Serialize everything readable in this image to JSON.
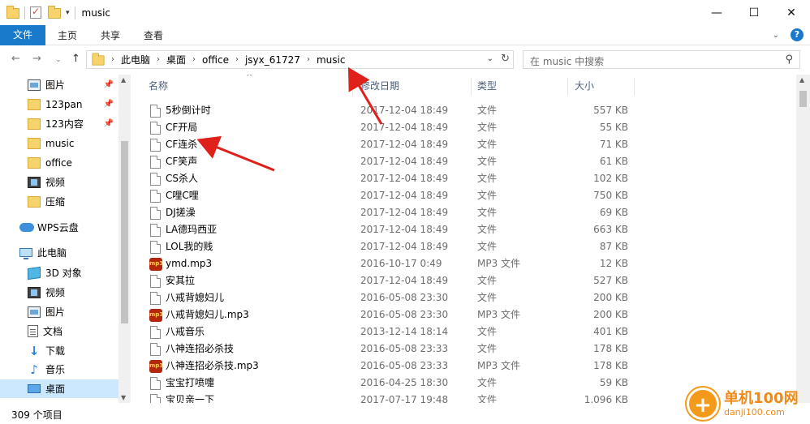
{
  "window": {
    "title": "music",
    "controls": {
      "minimize": "—",
      "maximize": "☐",
      "close": "✕"
    }
  },
  "ribbon": {
    "tabs": [
      "文件",
      "主页",
      "共享",
      "查看"
    ]
  },
  "address": {
    "breadcrumbs": [
      "此电脑",
      "桌面",
      "office",
      "jsyx_61727",
      "music"
    ],
    "search_placeholder": "在 music 中搜索"
  },
  "nav": {
    "items": [
      {
        "label": "图片",
        "icon": "pictures-icon",
        "pinned": true
      },
      {
        "label": "123pan",
        "icon": "folder-icon",
        "pinned": true
      },
      {
        "label": "123内容",
        "icon": "folder-icon",
        "pinned": true
      },
      {
        "label": "music",
        "icon": "folder-icon",
        "pinned": false
      },
      {
        "label": "office",
        "icon": "folder-icon",
        "pinned": false
      },
      {
        "label": "视频",
        "icon": "video-icon",
        "pinned": false
      },
      {
        "label": "压缩",
        "icon": "folder-icon",
        "pinned": false
      },
      {
        "label": "WPS云盘",
        "icon": "cloud-icon",
        "pinned": false
      },
      {
        "label": "此电脑",
        "icon": "pc-icon",
        "pinned": false
      },
      {
        "label": "3D 对象",
        "icon": "3d-objects-icon",
        "pinned": false
      },
      {
        "label": "视频",
        "icon": "video-icon",
        "pinned": false
      },
      {
        "label": "图片",
        "icon": "pictures-icon",
        "pinned": false
      },
      {
        "label": "文档",
        "icon": "documents-icon",
        "pinned": false
      },
      {
        "label": "下载",
        "icon": "download-icon",
        "pinned": false
      },
      {
        "label": "音乐",
        "icon": "music-icon",
        "pinned": false
      },
      {
        "label": "桌面",
        "icon": "desktop-icon",
        "pinned": false,
        "selected": true
      }
    ]
  },
  "files": {
    "columns": {
      "name": "名称",
      "modified": "修改日期",
      "type": "类型",
      "size": "大小"
    },
    "rows": [
      {
        "name": "5秒倒计时",
        "modified": "2017-12-04 18:49",
        "type": "文件",
        "size": "557 KB",
        "icon": "blank"
      },
      {
        "name": "CF开局",
        "modified": "2017-12-04 18:49",
        "type": "文件",
        "size": "55 KB",
        "icon": "blank"
      },
      {
        "name": "CF连杀",
        "modified": "2017-12-04 18:49",
        "type": "文件",
        "size": "71 KB",
        "icon": "blank"
      },
      {
        "name": "CF笑声",
        "modified": "2017-12-04 18:49",
        "type": "文件",
        "size": "61 KB",
        "icon": "blank"
      },
      {
        "name": "CS杀人",
        "modified": "2017-12-04 18:49",
        "type": "文件",
        "size": "102 KB",
        "icon": "blank"
      },
      {
        "name": "C哩C哩",
        "modified": "2017-12-04 18:49",
        "type": "文件",
        "size": "750 KB",
        "icon": "blank"
      },
      {
        "name": "DJ搓澡",
        "modified": "2017-12-04 18:49",
        "type": "文件",
        "size": "69 KB",
        "icon": "blank"
      },
      {
        "name": "LA德玛西亚",
        "modified": "2017-12-04 18:49",
        "type": "文件",
        "size": "663 KB",
        "icon": "blank"
      },
      {
        "name": "LOL我的贱",
        "modified": "2017-12-04 18:49",
        "type": "文件",
        "size": "87 KB",
        "icon": "blank"
      },
      {
        "name": "ymd.mp3",
        "modified": "2016-10-17 0:49",
        "type": "MP3 文件",
        "size": "12 KB",
        "icon": "mp3"
      },
      {
        "name": "安其拉",
        "modified": "2017-12-04 18:49",
        "type": "文件",
        "size": "527 KB",
        "icon": "blank"
      },
      {
        "name": "八戒背媳妇儿",
        "modified": "2016-05-08 23:30",
        "type": "文件",
        "size": "200 KB",
        "icon": "blank"
      },
      {
        "name": "八戒背媳妇儿.mp3",
        "modified": "2016-05-08 23:30",
        "type": "MP3 文件",
        "size": "200 KB",
        "icon": "mp3"
      },
      {
        "name": "八戒音乐",
        "modified": "2013-12-14 18:14",
        "type": "文件",
        "size": "401 KB",
        "icon": "blank"
      },
      {
        "name": "八神连招必杀技",
        "modified": "2016-05-08 23:33",
        "type": "文件",
        "size": "178 KB",
        "icon": "blank"
      },
      {
        "name": "八神连招必杀技.mp3",
        "modified": "2016-05-08 23:33",
        "type": "MP3 文件",
        "size": "178 KB",
        "icon": "mp3"
      },
      {
        "name": "宝宝打喷嚏",
        "modified": "2016-04-25 18:30",
        "type": "文件",
        "size": "59 KB",
        "icon": "blank"
      },
      {
        "name": "宝贝亲一下",
        "modified": "2017-07-17 19:48",
        "type": "文件",
        "size": "1,096 KB",
        "icon": "blank"
      }
    ]
  },
  "status": {
    "item_count": "309 个项目"
  },
  "watermark": {
    "name": "单机100网",
    "url": "danji100.com"
  },
  "colors": {
    "accent": "#1979ca",
    "selection": "#cce8ff",
    "annotation": "#e0201b"
  }
}
